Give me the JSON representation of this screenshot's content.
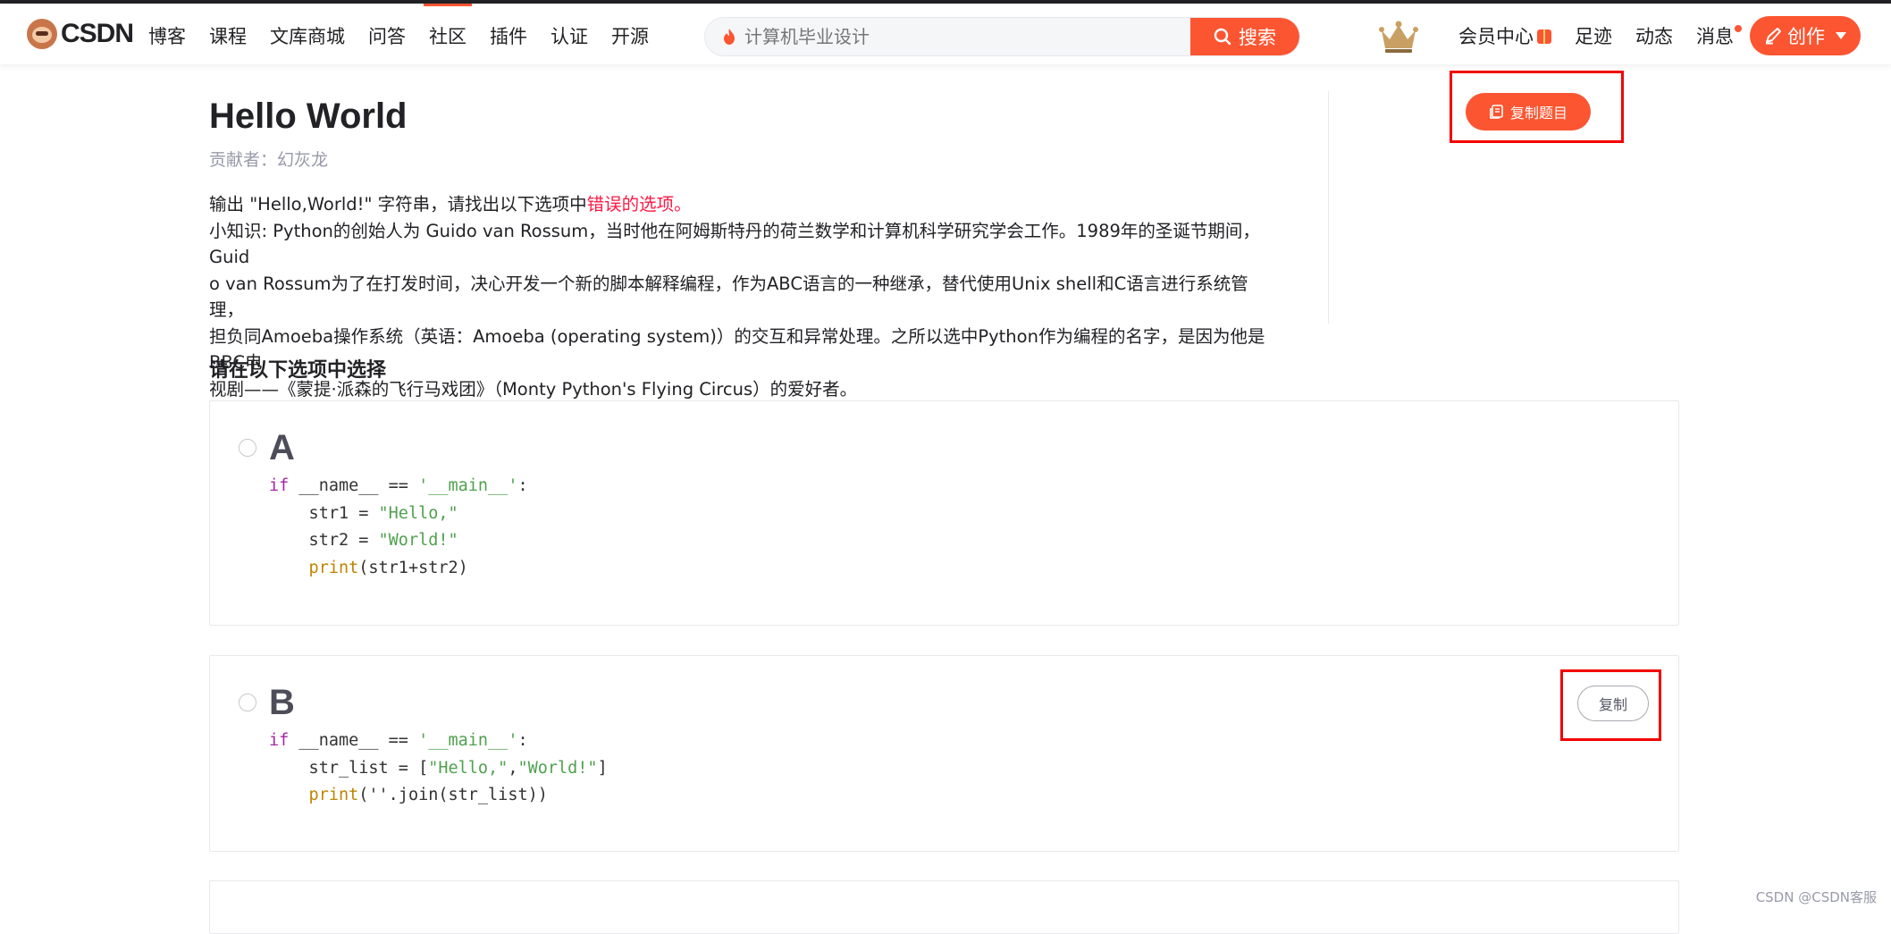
{
  "nav": {
    "brand": "CSDN",
    "menu": [
      "博客",
      "课程",
      "文库商城",
      "问答",
      "社区",
      "插件",
      "认证",
      "开源"
    ],
    "active_index": 4,
    "search_placeholder": "计算机毕业设计",
    "search_button": "搜索",
    "right": [
      "会员中心",
      "足迹",
      "动态",
      "消息"
    ],
    "create_button": "创作"
  },
  "question": {
    "title": "Hello World",
    "contributor": "贡献者：幻灰龙",
    "desc_prefix": "输出 \"Hello,World!\" 字符串，请找出以下选项中",
    "desc_highlight": "错误的选项。",
    "desc_line1": "小知识: Python的创始人为 Guido van Rossum，当时他在阿姆斯特丹的荷兰数学和计算机科学研究学会工作。1989年的圣诞节期间，Guid",
    "desc_line2": "o van Rossum为了在打发时间，决心开发一个新的脚本解释编程，作为ABC语言的一种继承，替代使用Unix shell和C语言进行系统管理，",
    "desc_line3": "担负同Amoeba操作系统（英语：Amoeba (operating system)）的交互和异常处理。之所以选中Python作为编程的名字，是因为他是BBC电",
    "desc_line4": "视剧——《蒙提·派森的飞行马戏团》（Monty Python's Flying Circus）的爱好者。",
    "copy_question_button": "复制题目",
    "section_title": "请在以下选项中选择"
  },
  "options": [
    {
      "letter": "A",
      "code": {
        "l1_kw": "if",
        "l1_mid": " __name__ == ",
        "l1_str": "'__main__'",
        "l1_end": ":",
        "l2_a": "    str1 = ",
        "l2_str": "\"Hello,\"",
        "l3_a": "    str2 = ",
        "l3_str": "\"World!\"",
        "l4_fn": "    print",
        "l4_rest": "(str1+str2)"
      }
    },
    {
      "letter": "B",
      "copy_button": "复制",
      "code": {
        "l1_kw": "if",
        "l1_mid": " __name__ == ",
        "l1_str": "'__main__'",
        "l1_end": ":",
        "l2_a": "    str_list = [",
        "l2_s1": "\"Hello,\"",
        "l2_comma": ",",
        "l2_s2": "\"World!\"",
        "l2_end": "]",
        "l3_fn": "    print",
        "l3_rest": "(''.join(str_list))"
      }
    }
  ],
  "watermark": "CSDN @CSDN客服",
  "colors": {
    "accent": "#fc5531",
    "highlight_box": "#f20000",
    "error_text": "#fc1944"
  }
}
